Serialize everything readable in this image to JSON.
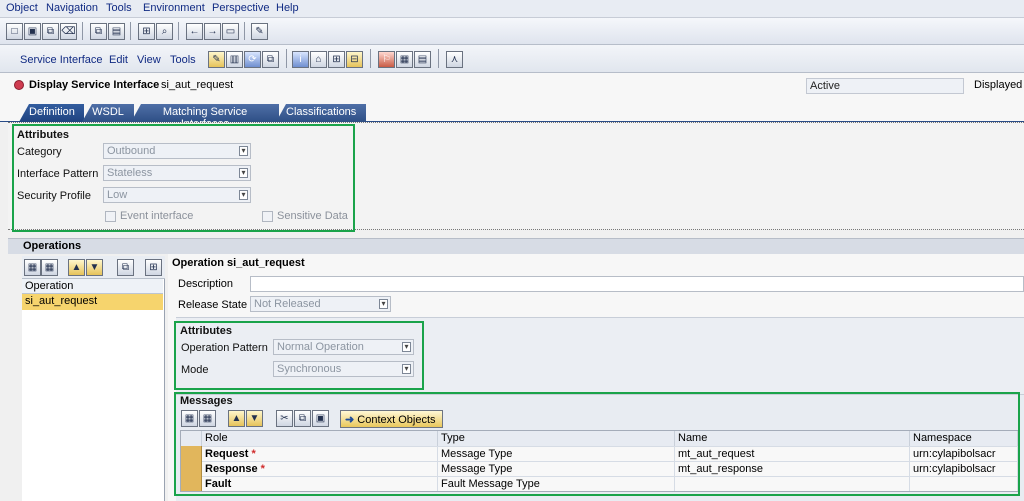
{
  "menubar": {
    "items": [
      "Object",
      "Navigation",
      "Tools",
      "Environment",
      "Perspective",
      "Help"
    ]
  },
  "app_menu": {
    "items": [
      "Service Interface",
      "Edit",
      "View",
      "Tools"
    ]
  },
  "titleline": {
    "title": "Display Service Interface",
    "object": "si_aut_request",
    "status": "Active",
    "displayed": "Displayed"
  },
  "tabs": [
    "Definition",
    "WSDL",
    "Matching Service Interfaces",
    "Classifications"
  ],
  "attributes": {
    "heading": "Attributes",
    "category_label": "Category",
    "category_value": "Outbound",
    "interface_pattern_label": "Interface Pattern",
    "interface_pattern_value": "Stateless",
    "security_profile_label": "Security Profile",
    "security_profile_value": "Low",
    "event_interface": "Event interface",
    "sensitive_data": "Sensitive Data"
  },
  "operations": {
    "heading": "Operations",
    "list_header": "Operation",
    "selected": "si_aut_request",
    "detail_title": "Operation si_aut_request",
    "description_label": "Description",
    "release_state_label": "Release State",
    "release_state_value": "Not Released"
  },
  "operation_attributes": {
    "heading": "Attributes",
    "operation_pattern_label": "Operation Pattern",
    "operation_pattern_value": "Normal Operation",
    "mode_label": "Mode",
    "mode_value": "Synchronous"
  },
  "messages": {
    "heading": "Messages",
    "context_button": "Context Objects",
    "columns": [
      "Role",
      "Type",
      "Name",
      "Namespace"
    ],
    "rows": [
      {
        "role": "Request",
        "required": "*",
        "type": "Message Type",
        "name": "mt_aut_request",
        "namespace": "urn:cylapibolsacr"
      },
      {
        "role": "Response",
        "required": "*",
        "type": "Message Type",
        "name": "mt_aut_response",
        "namespace": "urn:cylapibolsacr"
      },
      {
        "role": "Fault",
        "required": "",
        "type": "Fault Message Type",
        "name": "",
        "namespace": ""
      }
    ]
  }
}
